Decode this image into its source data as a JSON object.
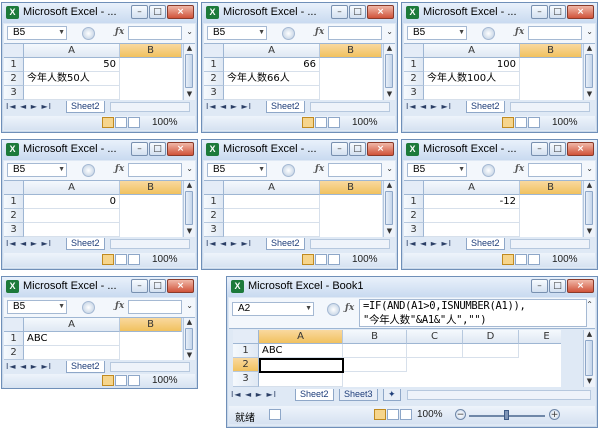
{
  "windows": [
    {
      "title": "Microsoft Excel - ...",
      "namebox": "B5",
      "fx": "fx",
      "col_a": "A",
      "col_b": "B",
      "rows": [
        "1",
        "2",
        "3"
      ],
      "a1": "50",
      "a2": "今年人数50人",
      "tab": "Sheet2",
      "zoom": "100%"
    },
    {
      "title": "Microsoft Excel - ...",
      "namebox": "B5",
      "fx": "fx",
      "col_a": "A",
      "col_b": "B",
      "rows": [
        "1",
        "2",
        "3"
      ],
      "a1": "66",
      "a2": "今年人数66人",
      "tab": "Sheet2",
      "zoom": "100%"
    },
    {
      "title": "Microsoft Excel - ...",
      "namebox": "B5",
      "fx": "fx",
      "col_a": "A",
      "col_b": "B",
      "rows": [
        "1",
        "2",
        "3"
      ],
      "a1": "100",
      "a2": "今年人数100人",
      "tab": "Sheet2",
      "zoom": "100%"
    },
    {
      "title": "Microsoft Excel - ...",
      "namebox": "B5",
      "fx": "fx",
      "col_a": "A",
      "col_b": "B",
      "rows": [
        "1",
        "2",
        "3"
      ],
      "a1": "0",
      "a2": "",
      "tab": "Sheet2",
      "zoom": "100%"
    },
    {
      "title": "Microsoft Excel - ...",
      "namebox": "B5",
      "fx": "fx",
      "col_a": "A",
      "col_b": "B",
      "rows": [
        "1",
        "2",
        "3"
      ],
      "a1": "",
      "a2": "",
      "tab": "Sheet2",
      "zoom": "100%"
    },
    {
      "title": "Microsoft Excel - ...",
      "namebox": "B5",
      "fx": "fx",
      "col_a": "A",
      "col_b": "B",
      "rows": [
        "1",
        "2",
        "3"
      ],
      "a1": "-12",
      "a2": "",
      "tab": "Sheet2",
      "zoom": "100%"
    },
    {
      "title": "Microsoft Excel - ...",
      "namebox": "B5",
      "fx": "fx",
      "col_a": "A",
      "col_b": "B",
      "rows": [
        "1",
        "2",
        "3"
      ],
      "a1": "ABC",
      "a2": "",
      "tab": "Sheet2",
      "zoom": "100%"
    }
  ],
  "main": {
    "title": "Microsoft Excel - Book1",
    "namebox": "A2",
    "fx": "fx",
    "formula_line1": "=IF(AND(A1>0,ISNUMBER(A1)),",
    "formula_line2": "\"今年人数\"&A1&\"人\",\"\")",
    "columns": [
      "A",
      "B",
      "C",
      "D",
      "E"
    ],
    "rows": [
      "1",
      "2",
      "3"
    ],
    "a1": "ABC",
    "tabs": [
      "Sheet2",
      "Sheet3"
    ],
    "status": "就绪",
    "zoom": "100%"
  },
  "icons": {
    "app": "excel-icon",
    "minimize": "minimize-icon",
    "maximize": "maximize-icon",
    "close": "close-icon"
  },
  "colors": {
    "accent_header": "#f1c15f",
    "window_frame": "#dfe9f5",
    "title_gradient": "#c9daf0"
  }
}
